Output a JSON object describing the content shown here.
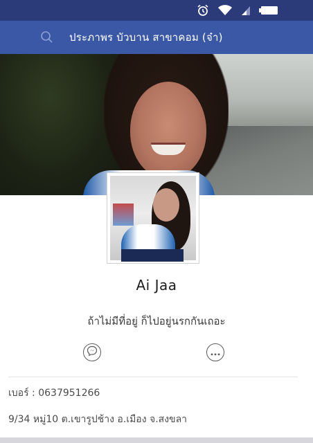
{
  "status_bar": {
    "icons": [
      "alarm-icon",
      "wifi-icon",
      "signal-icon",
      "battery-icon"
    ]
  },
  "header": {
    "search_icon": "search-icon",
    "title": "ประภาพร บัวบาน  สาขาคอม  (จ๋า)"
  },
  "profile": {
    "name": "Ai Jaa",
    "bio": "ถ้าไม่มีที่อยู่ ก็ไปอยู่นรกกันเถอะ",
    "actions": [
      "messenger-icon",
      "more-options-icon"
    ]
  },
  "info": {
    "phone": "เบอร์ : 0637951266",
    "address": "9/34 หมู่10 ต.เขารูปช้าง อ.เมือง จ.สงขลา"
  },
  "colors": {
    "status_bar": "#2b3b7a",
    "header": "#3b58a6",
    "text_dark": "#1d1d1d",
    "text_muted": "#4a4a4a"
  }
}
